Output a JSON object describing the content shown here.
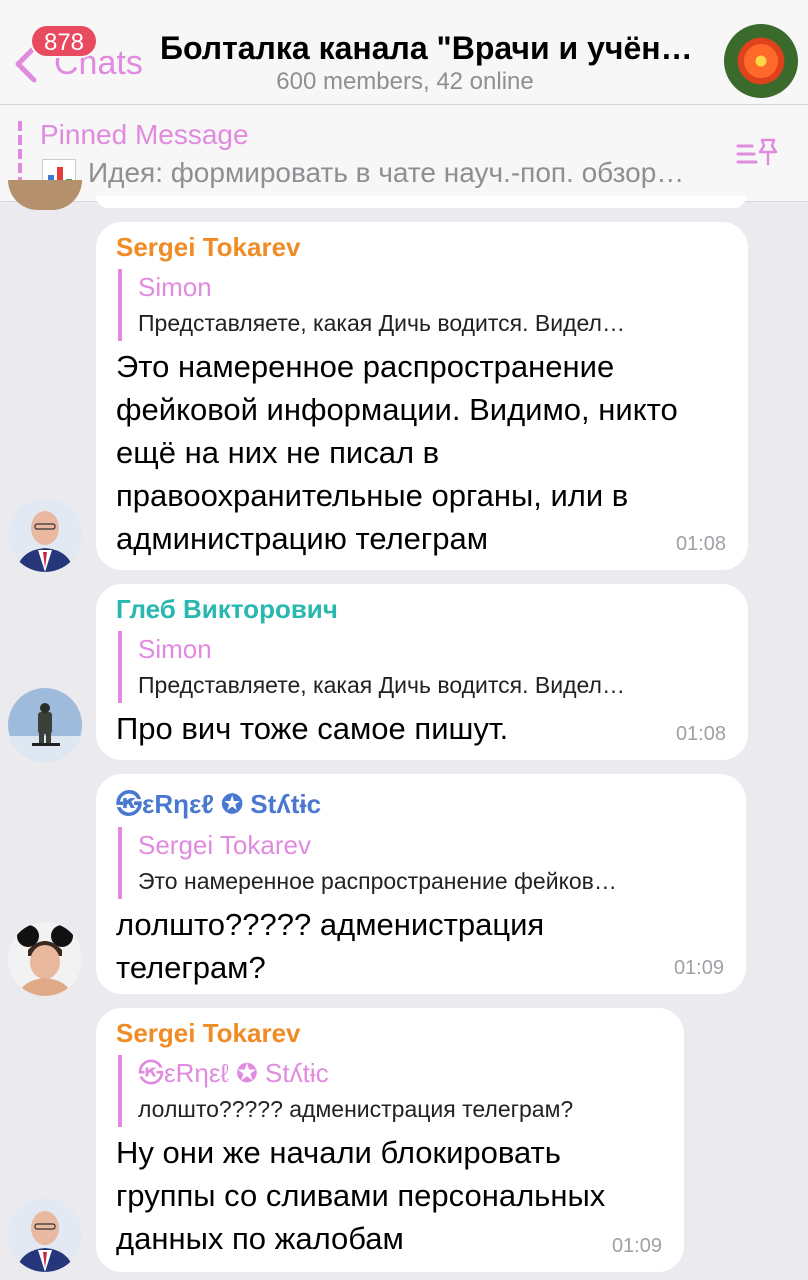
{
  "header": {
    "back_label": "Chats",
    "unread_badge": "878",
    "title": "Болталка канала \"Врачи и учён…",
    "subtitle": "600 members, 42 online"
  },
  "pinned": {
    "label": "Pinned Message",
    "text": "Идея: формировать в чате науч.-поп. обзор…"
  },
  "messages": [
    {
      "sender": "Sergei Tokarev",
      "sender_color": "#f08c26",
      "reply_name": "Simon",
      "reply_text": "Представляете, какая Дичь водится. Видел…",
      "text": "Это намеренное распространение фейковой информации. Видимо, никто ещё на них не писал в правоохранительные органы, или в администрацию телеграм",
      "time": "01:08"
    },
    {
      "sender": "Глеб Викторович",
      "sender_color": "#28b8b0",
      "reply_name": "Simon",
      "reply_text": "Представляете, какая Дичь водится. Видел…",
      "text": "Про вич тоже самое пишут.",
      "time": "01:08"
    },
    {
      "sender": "㉿εRηεℓ ✪ Stʎtɨc",
      "sender_color": "#4a78d0",
      "reply_name": "Sergei Tokarev",
      "reply_text": "Это намеренное распространение фейков…",
      "text": "лолшто????? адменистрация телеграм?",
      "time": "01:09"
    },
    {
      "sender": "Sergei Tokarev",
      "sender_color": "#f08c26",
      "reply_name": "㉿εRηεℓ ✪ Stʎtɨc",
      "reply_text": "лолшто????? адменистрация телеграм?",
      "text": "Ну они же начали блокировать группы со сливами персональных данных по жалобам",
      "time": "01:09"
    }
  ],
  "colors": {
    "accent": "#e08ae0",
    "badge": "#e84a5f",
    "background": "#ebebef"
  }
}
